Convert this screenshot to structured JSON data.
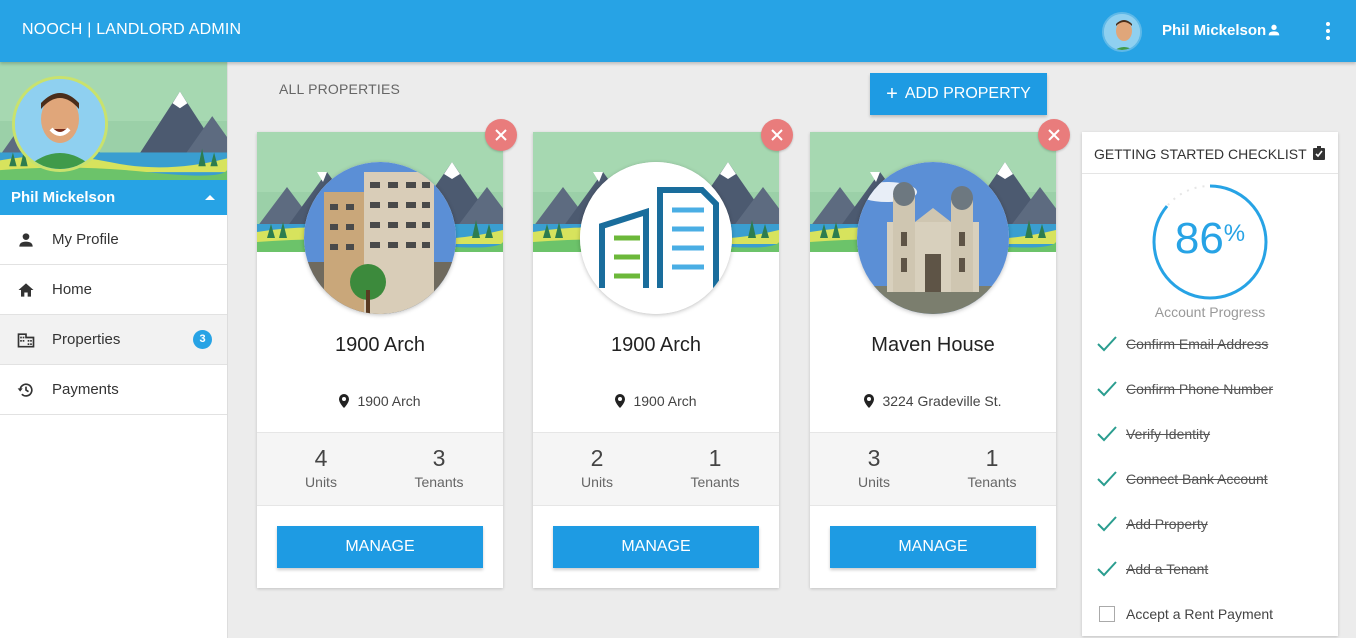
{
  "header": {
    "app_title": "NOOCH | LANDLORD ADMIN",
    "user_name": "Phil Mickelson",
    "avatar_icon": "user-avatar",
    "person_icon": "person-icon",
    "menu_icon": "more-vert-icon",
    "color": "#27a3e5"
  },
  "sidebar": {
    "user_name": "Phil Mickelson",
    "items": [
      {
        "label": "My Profile",
        "icon": "person-icon"
      },
      {
        "label": "Home",
        "icon": "home-icon"
      },
      {
        "label": "Properties",
        "icon": "building-icon",
        "badge": "3",
        "active": true
      },
      {
        "label": "Payments",
        "icon": "history-icon"
      }
    ]
  },
  "main": {
    "section_title": "ALL PROPERTIES",
    "add_button": "ADD PROPERTY"
  },
  "cards": [
    {
      "name": "1900 Arch",
      "address": "1900 Arch",
      "units": "4",
      "units_label": "Units",
      "tenants": "3",
      "tenants_label": "Tenants",
      "button": "MANAGE",
      "photo": "apartment-building-photo"
    },
    {
      "name": "1900 Arch",
      "address": "1900 Arch",
      "units": "2",
      "units_label": "Units",
      "tenants": "1",
      "tenants_label": "Tenants",
      "button": "MANAGE",
      "photo": "building-logo-icon"
    },
    {
      "name": "Maven House",
      "address": "3224 Gradeville St.",
      "units": "3",
      "units_label": "Units",
      "tenants": "1",
      "tenants_label": "Tenants",
      "button": "MANAGE",
      "photo": "church-photo"
    }
  ],
  "checklist": {
    "title": "GETTING STARTED CHECKLIST",
    "progress": "86",
    "progress_fraction": 0.86,
    "progress_unit": "%",
    "progress_label": "Account Progress",
    "items": [
      {
        "label": "Confirm Email Address",
        "done": true
      },
      {
        "label": "Confirm Phone Number",
        "done": true
      },
      {
        "label": "Verify Identity",
        "done": true
      },
      {
        "label": "Connect Bank Account",
        "done": true
      },
      {
        "label": "Add Property",
        "done": true
      },
      {
        "label": "Add a Tenant",
        "done": true
      },
      {
        "label": "Accept a Rent Payment",
        "done": false
      }
    ]
  },
  "colors": {
    "accent": "#27a3e5",
    "button": "#1e9be3",
    "close": "#e97c7c",
    "check": "#2a9d8f"
  }
}
